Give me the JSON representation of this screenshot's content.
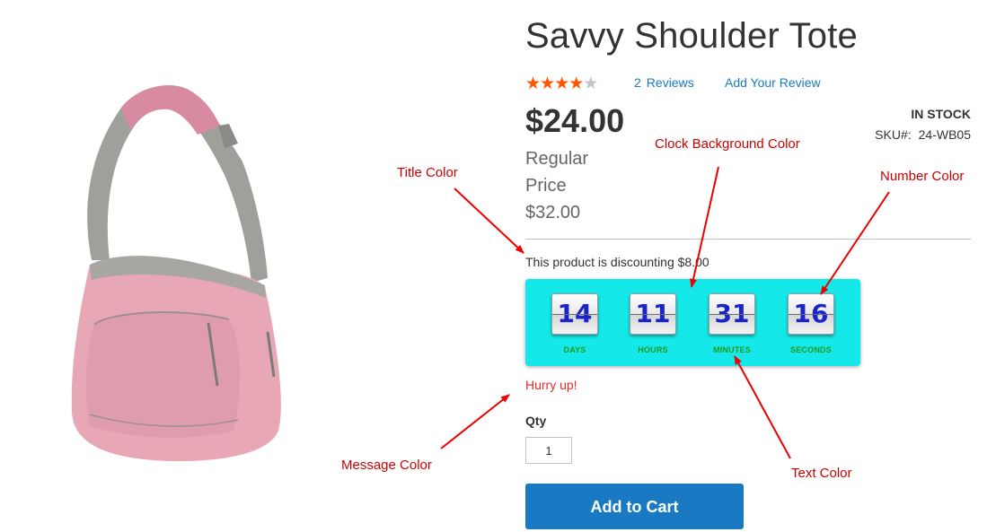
{
  "product": {
    "title": "Savvy Shoulder Tote",
    "rating_stars": 4,
    "rating_max": 5,
    "reviews_count": "2",
    "reviews_label": "Reviews",
    "add_review_label": "Add Your Review",
    "price": "$24.00",
    "regular_price_label": "Regular Price",
    "regular_price": "$32.00",
    "stock_status": "IN STOCK",
    "sku_label": "SKU#:",
    "sku": "24-WB05",
    "image_icon": "pink-shoulder-tote-bag-image"
  },
  "countdown": {
    "discount_message": "This product is discounting $8.00",
    "clock_background_color": "#14e8e8",
    "number_color": "#1a24c9",
    "text_color": "#1b9a1b",
    "message_color": "#e02b27",
    "units": [
      {
        "value": "14",
        "label": "DAYS"
      },
      {
        "value": "11",
        "label": "HOURS"
      },
      {
        "value": "31",
        "label": "MINUTES"
      },
      {
        "value": "16",
        "label": "SECONDS"
      }
    ],
    "hurry_message": "Hurry up!"
  },
  "cart": {
    "qty_label": "Qty",
    "qty_value": "1",
    "add_to_cart_label": "Add to Cart",
    "button_color": "#1979c3"
  },
  "annotations": {
    "clock_background": "Clock Background Color",
    "title_color": "Title Color",
    "number_color": "Number Color",
    "message_color": "Message Color",
    "text_color": "Text Color",
    "arrow_color": "#ee0000"
  }
}
